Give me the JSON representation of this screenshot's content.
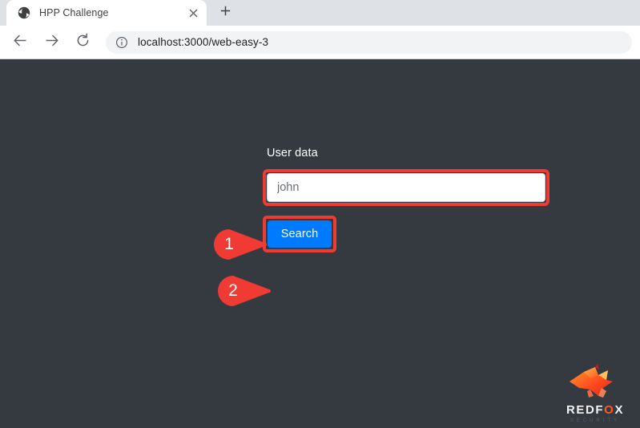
{
  "browser": {
    "tab": {
      "title": "HPP Challenge",
      "favicon_icon": "globe-icon",
      "close_icon": "close-icon"
    },
    "new_tab_icon": "plus-icon",
    "toolbar": {
      "back_icon": "back-arrow-icon",
      "forward_icon": "forward-arrow-icon",
      "reload_icon": "reload-icon",
      "site_info_icon": "info-circle-icon",
      "url": "localhost:3000/web-easy-3"
    }
  },
  "page": {
    "background_color": "#343a40",
    "form": {
      "label": "User data",
      "input_value": "john",
      "input_placeholder": "",
      "button_label": "Search",
      "button_color": "#007bff"
    },
    "annotations": {
      "highlight_color": "#ef3b33",
      "markers": [
        {
          "number": "1",
          "target": "user-data-input"
        },
        {
          "number": "2",
          "target": "search-button"
        }
      ]
    },
    "logo": {
      "name": "REDFOX",
      "name_before_o": "REDF",
      "name_o": "O",
      "name_after_o": "X",
      "subtitle": "SECURITY",
      "accent_color": "#ff5722"
    }
  }
}
